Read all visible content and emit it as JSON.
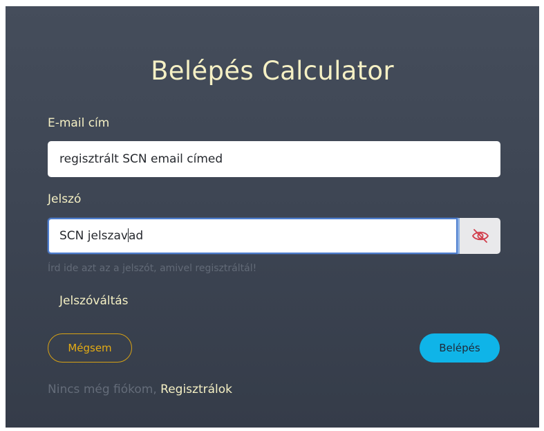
{
  "title": "Belépés Calculator",
  "email": {
    "label": "E-mail cím",
    "value": "regisztrált SCN email címed"
  },
  "password": {
    "label": "Jelszó",
    "value_before_caret": "SCN jelszav",
    "value_after_caret": "ad",
    "toggle_icon": "eye-slash-icon",
    "hint": "Írd ide azt az a jelszót, amivel regisztráltál!"
  },
  "change_password_link": "Jelszóváltás",
  "buttons": {
    "cancel": "Mégsem",
    "login": "Belépés"
  },
  "footer": {
    "text": "Nincs még fiókom,",
    "link": "Regisztrálok"
  },
  "colors": {
    "accent_text": "#f5f0c4",
    "cancel_border": "#d8a214",
    "login_bg": "#0fb4e8",
    "icon_red": "#d13c4a"
  }
}
